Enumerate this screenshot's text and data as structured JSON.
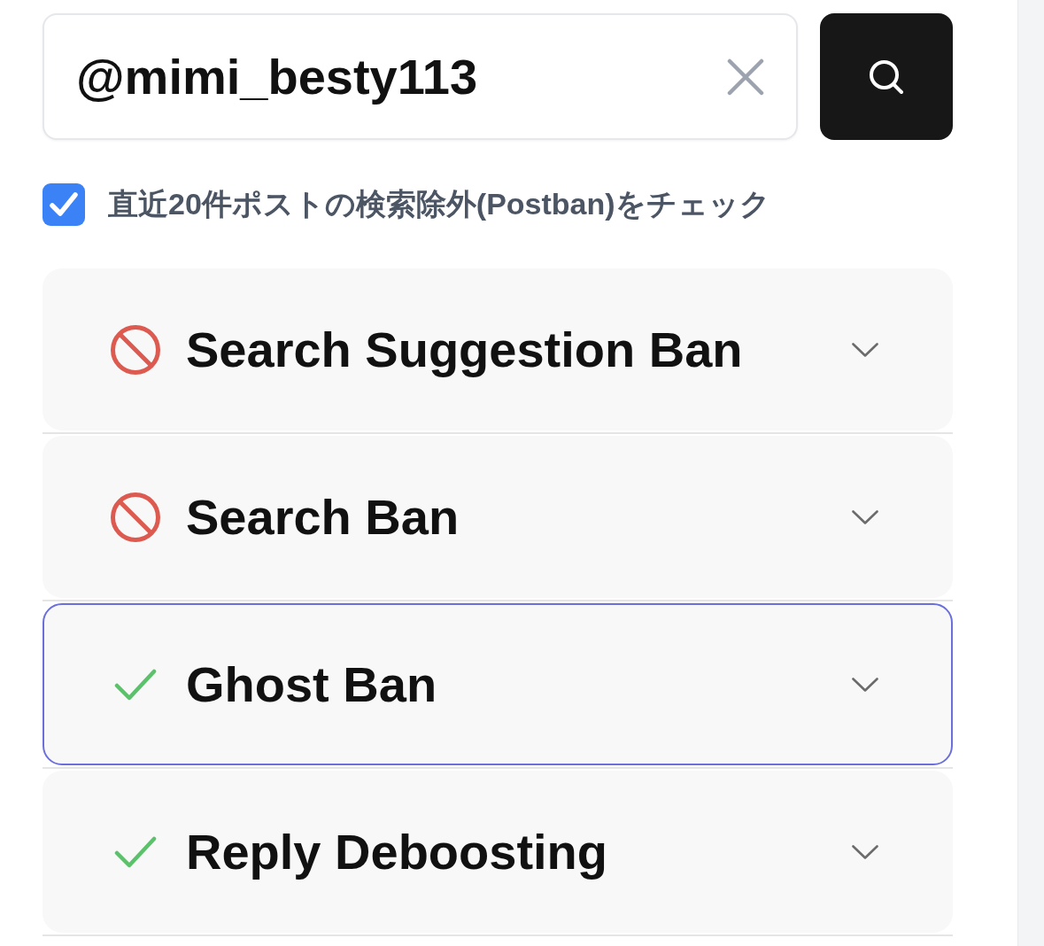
{
  "search": {
    "value": "@mimi_besty113"
  },
  "postban_check": {
    "label": "直近20件ポストの検索除外(Postban)をチェック",
    "checked": true
  },
  "results": [
    {
      "title": "Search Suggestion Ban",
      "kind": "banned",
      "expanded": false,
      "focused": false
    },
    {
      "title": "Search Ban",
      "kind": "banned",
      "expanded": false,
      "focused": false
    },
    {
      "title": "Ghost Ban",
      "kind": "clear",
      "expanded": false,
      "focused": true
    },
    {
      "title": "Reply Deboosting",
      "kind": "clear",
      "expanded": false,
      "focused": false
    }
  ]
}
